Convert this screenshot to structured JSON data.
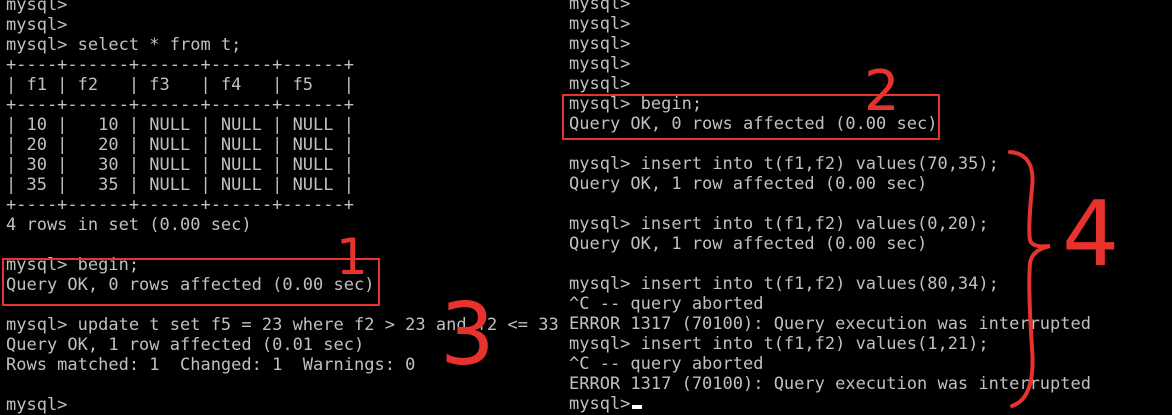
{
  "left_terminal": {
    "lines": [
      "mysql>",
      "mysql>",
      "mysql> select * from t;",
      "+----+------+------+------+------+",
      "| f1 | f2   | f3   | f4   | f5   |",
      "+----+------+------+------+------+",
      "| 10 |   10 | NULL | NULL | NULL |",
      "| 20 |   20 | NULL | NULL | NULL |",
      "| 30 |   30 | NULL | NULL | NULL |",
      "| 35 |   35 | NULL | NULL | NULL |",
      "+----+------+------+------+------+",
      "4 rows in set (0.00 sec)",
      "",
      "mysql> begin;",
      "Query OK, 0 rows affected (0.00 sec)",
      "",
      "mysql> update t set f5 = 23 where f2 > 23 and f2 <= 33;",
      "Query OK, 1 row affected (0.01 sec)",
      "Rows matched: 1  Changed: 1  Warnings: 0",
      "",
      "mysql>"
    ]
  },
  "right_terminal": {
    "lines": [
      "mysql>",
      "mysql>",
      "mysql>",
      "mysql>",
      "mysql>",
      "mysql> begin;",
      "Query OK, 0 rows affected (0.00 sec)",
      "",
      "mysql> insert into t(f1,f2) values(70,35);",
      "Query OK, 1 row affected (0.00 sec)",
      "",
      "mysql> insert into t(f1,f2) values(0,20);",
      "Query OK, 1 row affected (0.00 sec)",
      "",
      "mysql> insert into t(f1,f2) values(80,34);",
      "^C -- query aborted",
      "ERROR 1317 (70100): Query execution was interrupted",
      "mysql> insert into t(f1,f2) values(1,21);",
      "^C -- query aborted",
      "ERROR 1317 (70100): Query execution was interrupted",
      "mysql>"
    ]
  },
  "annotations": {
    "mark_1": "1",
    "mark_2": "2",
    "mark_3": "3",
    "mark_4": "4"
  },
  "colors": {
    "background": "#000000",
    "text": "#c0c0c0",
    "annotation": "#e8322d",
    "cursor": "#ffffff"
  }
}
